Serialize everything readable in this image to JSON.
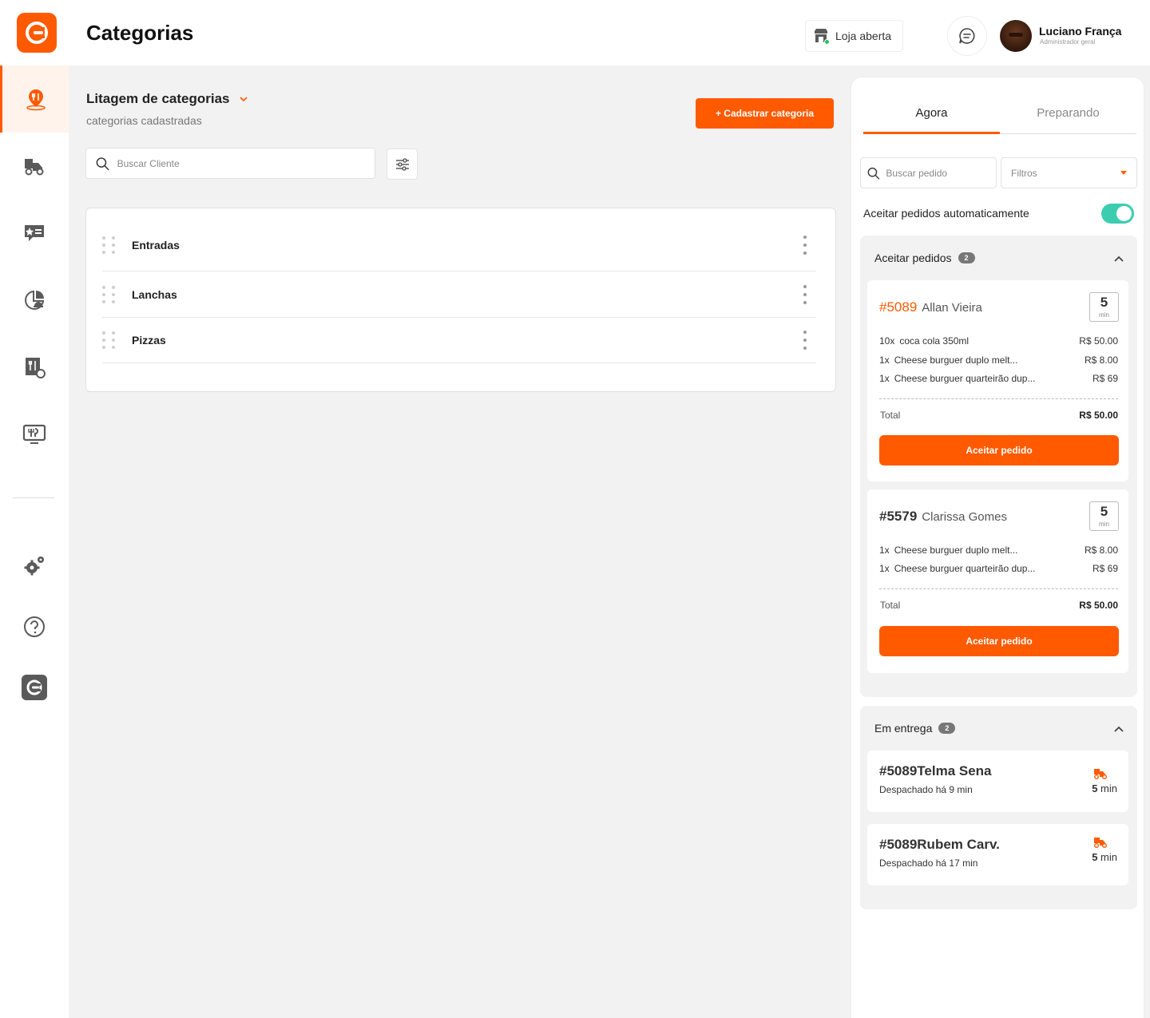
{
  "header": {
    "title": "Categorias",
    "store_status": "Loja aberta",
    "user": {
      "name": "Luciano França",
      "role": "Administrador geral"
    }
  },
  "sidebar": {
    "items": [
      {
        "icon": "restaurant-pin-icon",
        "active": true
      },
      {
        "icon": "delivery-truck-icon",
        "active": false
      },
      {
        "icon": "menu-card-icon",
        "active": false
      },
      {
        "icon": "reports-chart-icon",
        "active": false
      },
      {
        "icon": "menu-book-icon",
        "active": false
      },
      {
        "icon": "orders-screen-icon",
        "active": false
      }
    ],
    "bottom": [
      {
        "icon": "settings-gears-icon"
      },
      {
        "icon": "help-icon"
      },
      {
        "icon": "brand-logo-icon"
      }
    ]
  },
  "main": {
    "list_title": "Litagem de categorias",
    "list_subtitle": "categorias cadastradas",
    "add_button": "+ Cadastrar categoria",
    "search_placeholder": "Buscar Cliente",
    "categories": [
      "Entradas",
      "Lanchas",
      "Pizzas"
    ]
  },
  "panel": {
    "tabs": [
      "Agora",
      "Preparando"
    ],
    "active_tab": "Agora",
    "search_placeholder": "Buscar pedido",
    "filters_label": "Filtros",
    "auto_accept_label": "Aceitar pedidos automaticamente",
    "auto_accept_on": true,
    "accept_section": {
      "title": "Aceitar pedidos",
      "count": "2",
      "orders": [
        {
          "id": "#5089",
          "customer": "Allan Vieira",
          "time_value": "5",
          "time_unit": "min",
          "items": [
            {
              "qty": "10x",
              "name": "coca cola 350ml",
              "price": "R$ 50.00"
            },
            {
              "qty": "1x",
              "name": "Cheese burguer duplo melt...",
              "price": "R$ 8.00"
            },
            {
              "qty": "1x",
              "name": "Cheese burguer quarteirão dup...",
              "price": "R$ 69"
            }
          ],
          "total_label": "Total",
          "total_value": "R$ 50.00",
          "button": "Aceitar pedido"
        },
        {
          "id": "#5579",
          "customer": "Clarissa Gomes",
          "time_value": "5",
          "time_unit": "min",
          "items": [
            {
              "qty": "1x",
              "name": "Cheese burguer duplo melt...",
              "price": "R$ 8.00"
            },
            {
              "qty": "1x",
              "name": "Cheese burguer quarteirão dup...",
              "price": "R$ 69"
            }
          ],
          "total_label": "Total",
          "total_value": "R$ 50.00",
          "button": "Aceitar pedido"
        }
      ]
    },
    "delivery_section": {
      "title": "Em entrega",
      "count": "2",
      "orders": [
        {
          "id": "#5089",
          "customer": "Telma Sena",
          "status": "Despachado há 9 min",
          "eta_value": "5",
          "eta_unit": "min"
        },
        {
          "id": "#5089",
          "customer": "Rubem Carv.",
          "status": "Despachado há 17 min",
          "eta_value": "5",
          "eta_unit": "min"
        }
      ]
    }
  },
  "colors": {
    "accent": "#ff5a00",
    "toggle_on": "#3ccdb0",
    "background": "#f2f2f2",
    "icon_gray": "#5a5a5a"
  }
}
